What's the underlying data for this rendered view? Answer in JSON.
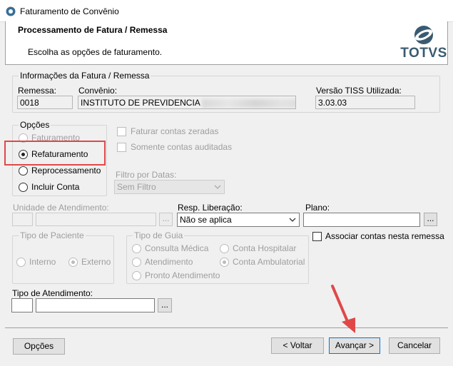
{
  "window": {
    "title": "Faturamento de Convênio"
  },
  "header": {
    "title": "Processamento de Fatura / Remessa",
    "subtitle": "Escolha as opções de faturamento.",
    "logo_text": "TOTVS"
  },
  "info": {
    "legend": "Informações da Fatura / Remessa",
    "remessa_label": "Remessa:",
    "remessa_value": "0018",
    "convenio_label": "Convênio:",
    "convenio_value": "INSTITUTO DE PREVIDENCIA",
    "versao_label": "Versão TISS Utilizada:",
    "versao_value": "3.03.03"
  },
  "opcoes": {
    "legend": "Opções",
    "items": [
      {
        "label": "Faturamento",
        "selected": false,
        "enabled": false
      },
      {
        "label": "Refaturamento",
        "selected": true,
        "enabled": true
      },
      {
        "label": "Reprocessamento",
        "selected": false,
        "enabled": true
      },
      {
        "label": "Incluir Conta",
        "selected": false,
        "enabled": true
      }
    ]
  },
  "checks": {
    "zeradas": "Faturar contas zeradas",
    "auditadas": "Somente contas auditadas",
    "associar": "Associar contas nesta remessa"
  },
  "filtro": {
    "label": "Filtro por Datas:",
    "value": "Sem Filtro"
  },
  "unidade": {
    "label": "Unidade de Atendimento:",
    "lookup": "..."
  },
  "resp": {
    "label": "Resp. Liberação:",
    "value": "Não se aplica"
  },
  "plano": {
    "label": "Plano:",
    "lookup": "..."
  },
  "tipo_paciente": {
    "legend": "Tipo de Paciente",
    "interno": "Interno",
    "externo": "Externo"
  },
  "tipo_guia": {
    "legend": "Tipo de Guia",
    "consulta": "Consulta Médica",
    "hospitalar": "Conta Hospitalar",
    "atendimento": "Atendimento",
    "ambulatorial": "Conta Ambulatorial",
    "pronto": "Pronto Atendimento"
  },
  "tipo_atendimento": {
    "label": "Tipo de Atendimento:",
    "lookup": "..."
  },
  "footer": {
    "opcoes": "Opções",
    "voltar": "< Voltar",
    "avancar": "Avançar >",
    "cancelar": "Cancelar"
  },
  "colors": {
    "highlight": "#e04848",
    "logo": "#3a5a70",
    "accent": "#0078d7"
  }
}
